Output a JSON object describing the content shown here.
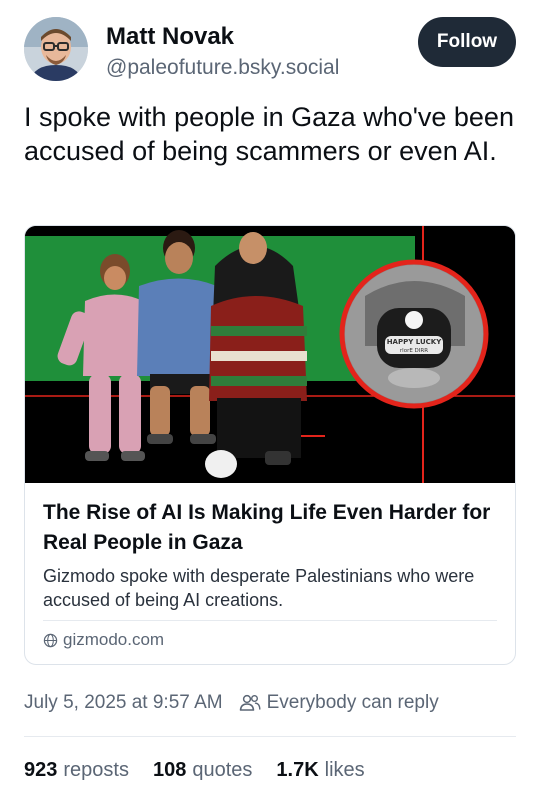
{
  "author": {
    "display_name": "Matt Novak",
    "handle": "@paleofuture.bsky.social"
  },
  "follow_label": "Follow",
  "post": {
    "text": "I spoke with people in Gaza who've been accused of being scammers or even AI."
  },
  "link_card": {
    "image_badge_text_1": "HAPPY LUCKY",
    "image_badge_text_2": "rlorE DIRR",
    "title": "The Rise of AI Is Making Life Even Harder for Real People in Gaza",
    "description": "Gizmodo spoke with desperate Palestinians who were accused of being AI creations.",
    "domain": "gizmodo.com"
  },
  "meta": {
    "timestamp": "July 5, 2025 at 9:57 AM",
    "reply_setting": "Everybody can reply"
  },
  "stats": {
    "reposts_count": "923",
    "reposts_label": "reposts",
    "quotes_count": "108",
    "quotes_label": "quotes",
    "likes_count": "1.7K",
    "likes_label": "likes"
  },
  "colors": {
    "follow_bg": "#1f2a37",
    "muted_text": "#5b6675",
    "image_green": "#1f8f3a",
    "image_red": "#e3241b"
  }
}
